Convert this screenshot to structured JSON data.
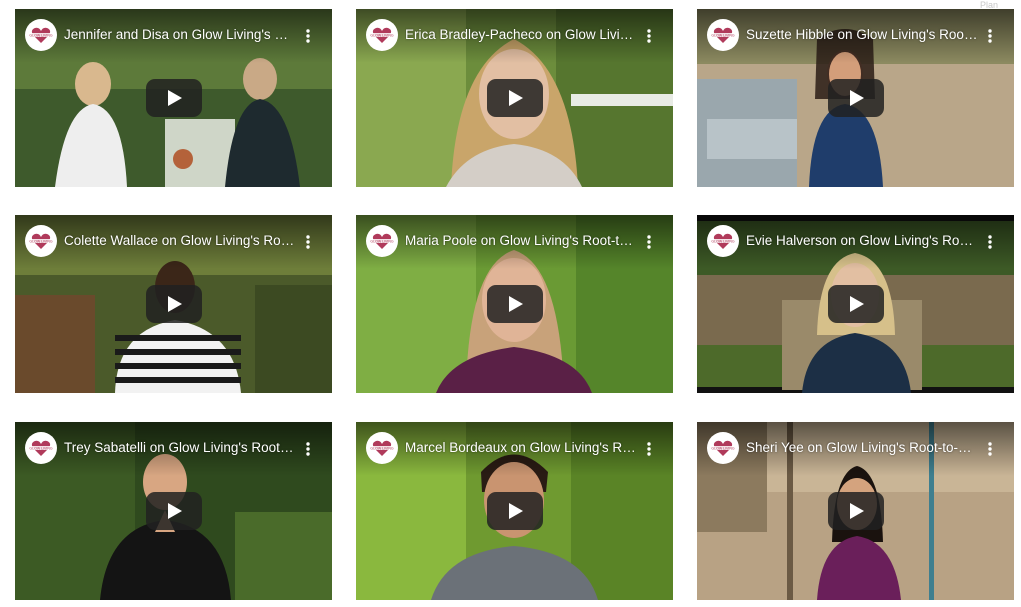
{
  "page": {
    "corner_text": "Plan Ahead"
  },
  "videos": [
    {
      "title": "Jennifer and Disa on Glow Living's Root-to-Rise Program",
      "channel_icon": "glow-living-logo",
      "play_icon": "youtube-play-icon"
    },
    {
      "title": "Erica Bradley-Pacheco on Glow Living's Root-to-Rise Program",
      "channel_icon": "glow-living-logo",
      "play_icon": "youtube-play-icon"
    },
    {
      "title": "Suzette Hibble on Glow Living's Root-to-Rise Program",
      "channel_icon": "glow-living-logo",
      "play_icon": "youtube-play-icon"
    },
    {
      "title": "Colette Wallace on Glow Living's Root-to-Rise Program",
      "channel_icon": "glow-living-logo",
      "play_icon": "youtube-play-icon"
    },
    {
      "title": "Maria Poole on Glow Living's Root-to-Rise Program",
      "channel_icon": "glow-living-logo",
      "play_icon": "youtube-play-icon"
    },
    {
      "title": "Evie Halverson on Glow Living's Root-to-Rise Program",
      "channel_icon": "glow-living-logo",
      "play_icon": "youtube-play-icon"
    },
    {
      "title": "Trey Sabatelli on Glow Living's Root-to-Rise Program",
      "channel_icon": "glow-living-logo",
      "play_icon": "youtube-play-icon"
    },
    {
      "title": "Marcel Bordeaux on Glow Living's Root-to-Rise Program",
      "channel_icon": "glow-living-logo",
      "play_icon": "youtube-play-icon"
    },
    {
      "title": "Sheri Yee on Glow Living's Root-to-Rise Program",
      "channel_icon": "glow-living-logo",
      "play_icon": "youtube-play-icon"
    }
  ],
  "colors": {
    "youtube_play_bg": "#212121",
    "channel_logo_heart": "#b03a5b"
  }
}
